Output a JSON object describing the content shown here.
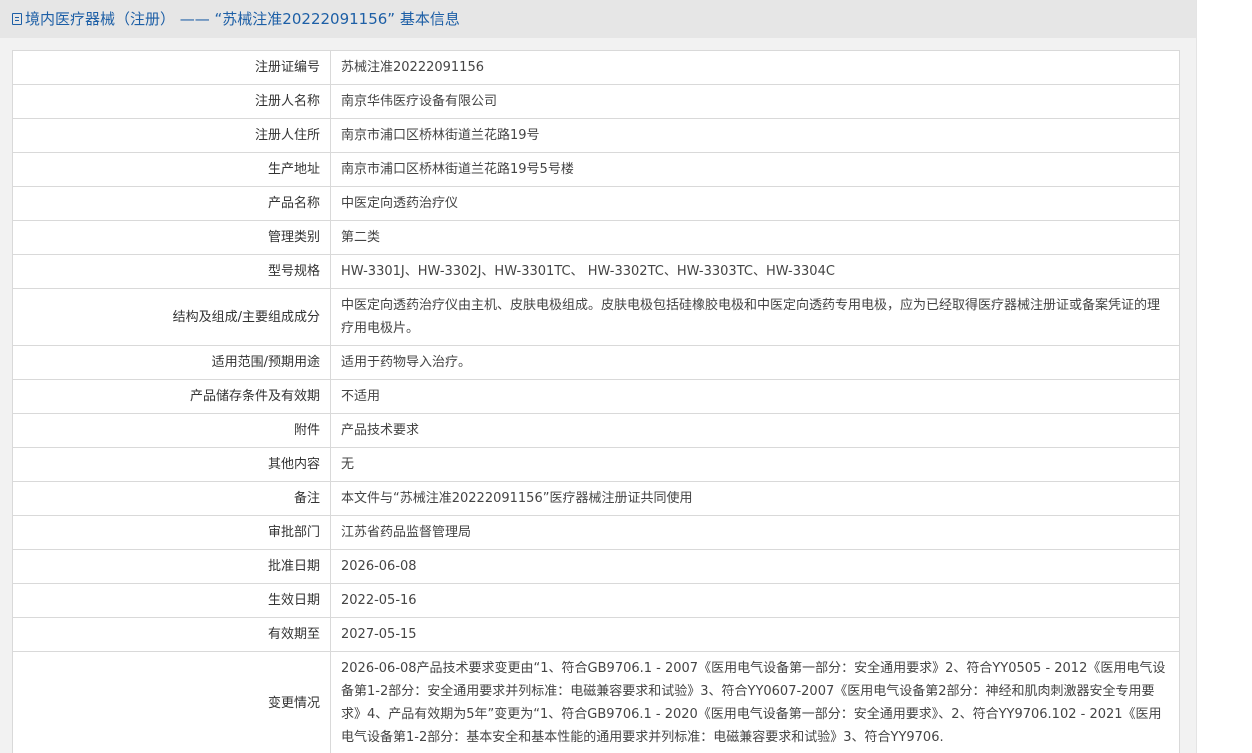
{
  "header": {
    "title": "境内医疗器械（注册） —— “苏械注准20222091156” 基本信息"
  },
  "rows": [
    {
      "label": "注册证编号",
      "value": "苏械注准20222091156"
    },
    {
      "label": "注册人名称",
      "value": "南京华伟医疗设备有限公司"
    },
    {
      "label": "注册人住所",
      "value": "南京市浦口区桥林街道兰花路19号"
    },
    {
      "label": "生产地址",
      "value": "南京市浦口区桥林街道兰花路19号5号楼"
    },
    {
      "label": "产品名称",
      "value": "中医定向透药治疗仪"
    },
    {
      "label": "管理类别",
      "value": "第二类"
    },
    {
      "label": "型号规格",
      "value": "HW-3301J、HW-3302J、HW-3301TC、 HW-3302TC、HW-3303TC、HW-3304C"
    },
    {
      "label": "结构及组成/主要组成成分",
      "value": "中医定向透药治疗仪由主机、皮肤电极组成。皮肤电极包括硅橡胶电极和中医定向透药专用电极，应为已经取得医疗器械注册证或备案凭证的理疗用电极片。"
    },
    {
      "label": "适用范围/预期用途",
      "value": "适用于药物导入治疗。"
    },
    {
      "label": "产品储存条件及有效期",
      "value": "不适用"
    },
    {
      "label": "附件",
      "value": "产品技术要求"
    },
    {
      "label": "其他内容",
      "value": "无"
    },
    {
      "label": "备注",
      "value": "本文件与“苏械注准20222091156”医疗器械注册证共同使用"
    },
    {
      "label": "审批部门",
      "value": "江苏省药品监督管理局"
    },
    {
      "label": "批准日期",
      "value": "2026-06-08"
    },
    {
      "label": "生效日期",
      "value": "2022-05-16"
    },
    {
      "label": "有效期至",
      "value": "2027-05-15"
    },
    {
      "label": "变更情况",
      "value": "2026-06-08产品技术要求变更由“1、符合GB9706.1 - 2007《医用电气设备第一部分：安全通用要求》2、符合YY0505 - 2012《医用电气设备第1-2部分：安全通用要求并列标准：电磁兼容要求和试验》3、符合YY0607-2007《医用电气设备第2部分：神经和肌肉刺激器安全专用要求》4、产品有效期为5年”变更为“1、符合GB9706.1 - 2020《医用电气设备第一部分：安全通用要求》、2、符合YY9706.102 - 2021《医用电气设备第1-2部分：基本安全和基本性能的通用要求并列标准：电磁兼容要求和试验》3、符合YY9706."
    }
  ]
}
